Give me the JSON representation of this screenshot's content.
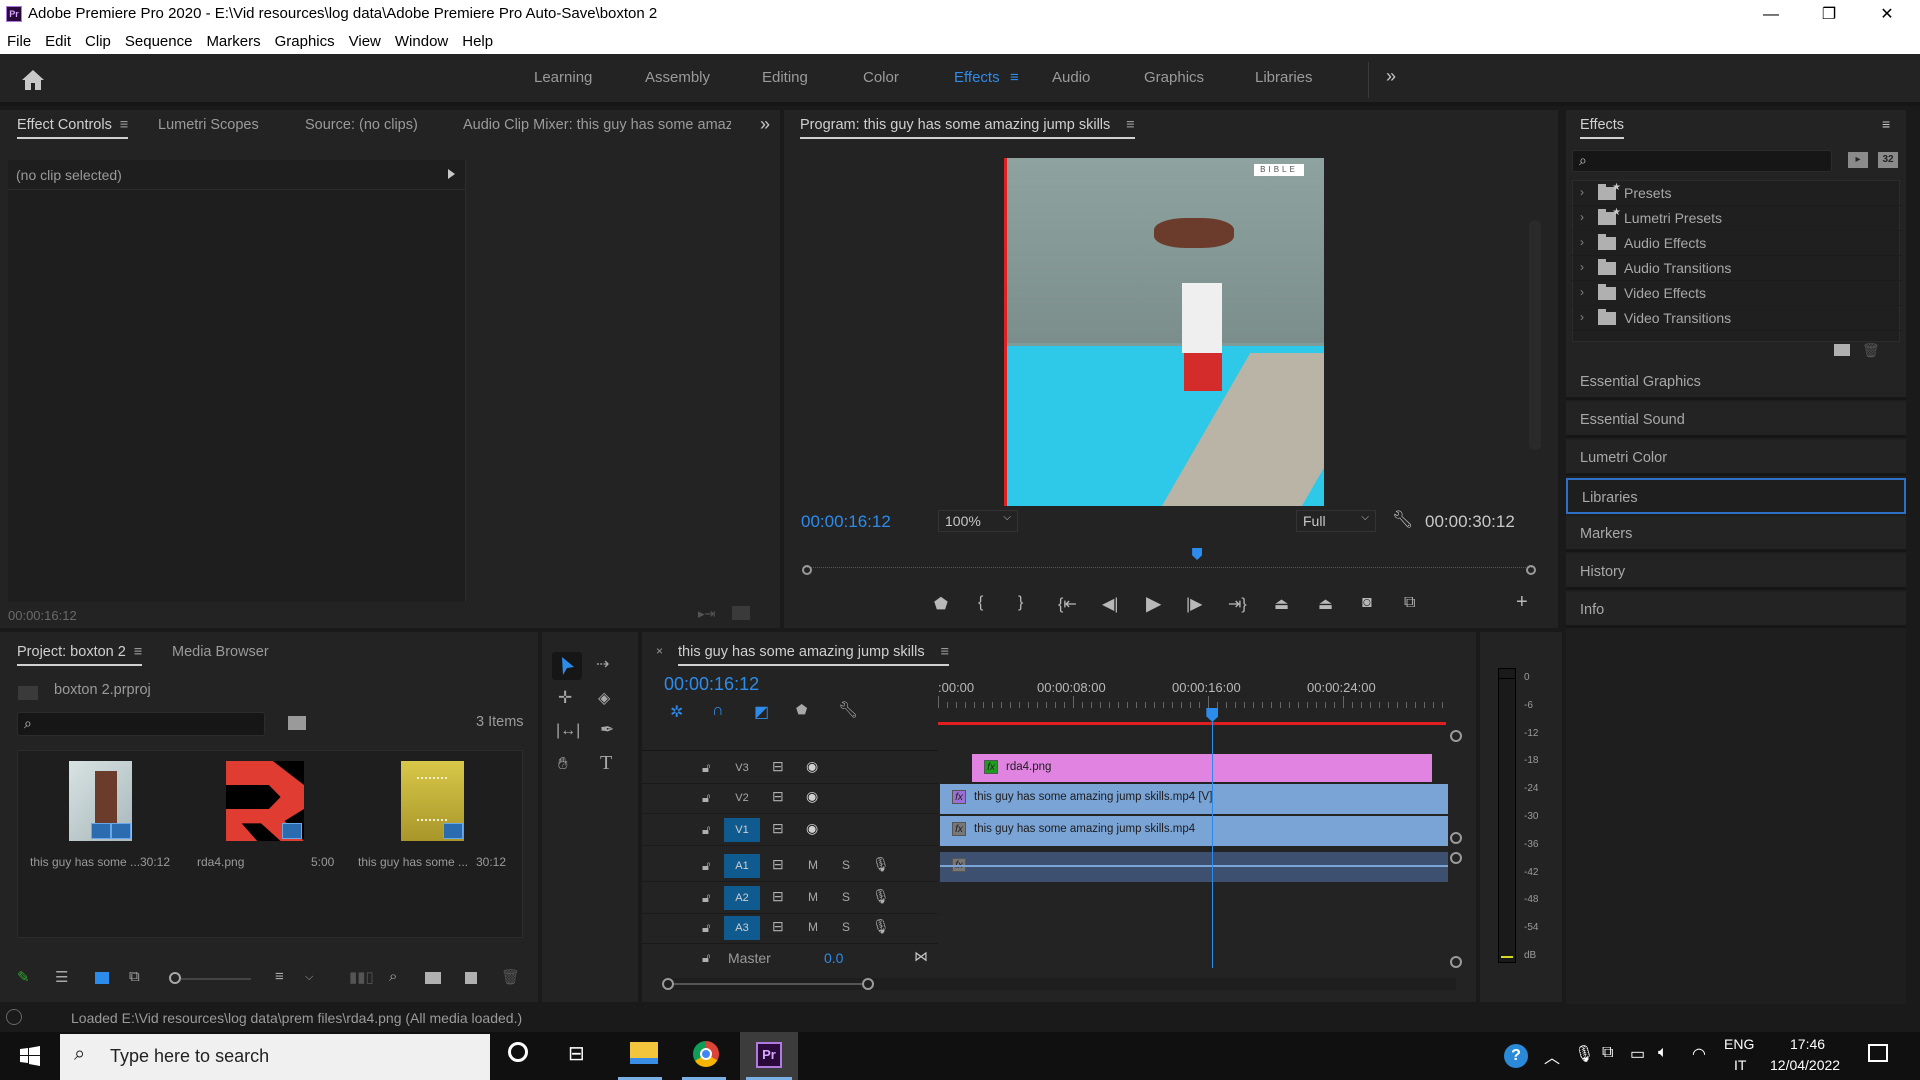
{
  "window": {
    "title": "Adobe Premiere Pro 2020 - E:\\Vid resources\\log data\\Adobe Premiere Pro Auto-Save\\boxton 2",
    "app_logo": "Pr",
    "controls": {
      "minimize": "—",
      "maximize": "❐",
      "close": "✕"
    }
  },
  "menu": [
    "File",
    "Edit",
    "Clip",
    "Sequence",
    "Markers",
    "Graphics",
    "View",
    "Window",
    "Help"
  ],
  "workspaces": {
    "items": [
      "Learning",
      "Assembly",
      "Editing",
      "Color",
      "Effects",
      "Audio",
      "Graphics",
      "Libraries"
    ],
    "active": "Effects",
    "overflow": "»"
  },
  "source_panel": {
    "tabs": [
      "Effect Controls",
      "Lumetri Scopes",
      "Source: (no clips)",
      "Audio Clip Mixer: this guy has some amazi"
    ],
    "active_tab": "Effect Controls",
    "no_clip_label": "(no clip selected)",
    "timecode": "00:00:16:12",
    "overflow": "»"
  },
  "program_monitor": {
    "title": "Program: this guy has some amazing jump skills",
    "video_watermark": "BIBLE",
    "timecode_current": "00:00:16:12",
    "zoom": "100%",
    "resolution": "Full",
    "timecode_duration": "00:00:30:12",
    "playhead_fraction": 0.54,
    "accent_color": "#2d8ceb"
  },
  "effects_panel": {
    "title": "Effects",
    "search_placeholder": "",
    "badge_32": "32",
    "folders": [
      {
        "label": "Presets",
        "starred": true
      },
      {
        "label": "Lumetri Presets",
        "starred": true
      },
      {
        "label": "Audio Effects",
        "starred": false
      },
      {
        "label": "Audio Transitions",
        "starred": false
      },
      {
        "label": "Video Effects",
        "starred": false
      },
      {
        "label": "Video Transitions",
        "starred": false
      }
    ]
  },
  "side_panels": [
    "Essential Graphics",
    "Essential Sound",
    "Lumetri Color",
    "Libraries",
    "Markers",
    "History",
    "Info"
  ],
  "side_panels_selected": "Libraries",
  "project_panel": {
    "tabs": [
      "Project: boxton 2",
      "Media Browser"
    ],
    "active_tab": "Project: boxton 2",
    "project_file": "boxton 2.prproj",
    "item_count": "3 Items",
    "items": [
      {
        "name": "this guy has some ...",
        "duration": "30:12",
        "kind": "video"
      },
      {
        "name": "rda4.png",
        "duration": "5:00",
        "kind": "image"
      },
      {
        "name": "this guy has some ...",
        "duration": "30:12",
        "kind": "sequence"
      }
    ]
  },
  "timeline": {
    "sequence_name": "this guy has some amazing jump skills",
    "timecode": "00:00:16:12",
    "ruler_labels": [
      ":00:00",
      "00:00:08:00",
      "00:00:16:00",
      "00:00:24:00"
    ],
    "playhead_fraction": 0.54,
    "video_tracks": [
      {
        "label": "V3",
        "targeted": false
      },
      {
        "label": "V2",
        "targeted": false
      },
      {
        "label": "V1",
        "targeted": true
      }
    ],
    "audio_tracks": [
      {
        "label": "A1",
        "targeted": true,
        "m": "M",
        "s": "S"
      },
      {
        "label": "A2",
        "targeted": true,
        "m": "M",
        "s": "S"
      },
      {
        "label": "A3",
        "targeted": true,
        "m": "M",
        "s": "S"
      }
    ],
    "master": {
      "label": "Master",
      "value": "0.0"
    },
    "clips": [
      {
        "track": "V3",
        "name": "rda4.png",
        "color": "#e184e1",
        "fx_color": "#1f9c1f"
      },
      {
        "track": "V2",
        "name": "this guy has some amazing jump skills.mp4 [V]",
        "color": "#7aa3d6",
        "fx_color": "#9b6fd6"
      },
      {
        "track": "V1",
        "name": "this guy has some amazing jump skills.mp4",
        "color": "#7aa3d6",
        "fx_color": "#777777"
      },
      {
        "track": "A1",
        "name": "",
        "color": "#3d5070",
        "fx_color": "#777777"
      }
    ]
  },
  "audio_meter": {
    "scale": [
      "0",
      "-6",
      "-12",
      "-18",
      "-24",
      "-30",
      "-36",
      "-42",
      "-48",
      "-54",
      "dB"
    ]
  },
  "status_bar": {
    "message": "Loaded E:\\Vid resources\\log data\\prem files\\rda4.png (All media loaded.)"
  },
  "taskbar": {
    "search_placeholder": "Type here to search",
    "language": "ENG",
    "keyboard": "IT",
    "time": "17:46",
    "date": "12/04/2022"
  }
}
